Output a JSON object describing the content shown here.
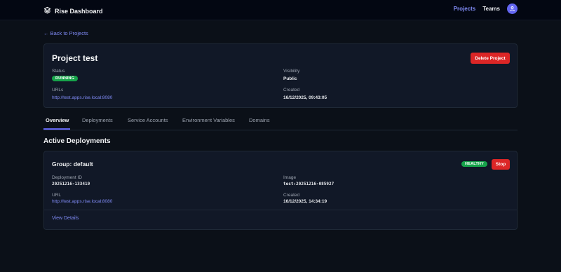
{
  "app": {
    "brand": "Rise Dashboard",
    "icon": "layers-icon"
  },
  "nav": {
    "projects": "Projects",
    "teams": "Teams",
    "avatar_icon": "user-icon"
  },
  "back_link": "← Back to Projects",
  "project": {
    "title": "Project test",
    "delete_label": "Delete Project",
    "status_label": "Status",
    "status_value": "RUNNING",
    "visibility_label": "Visibility",
    "visibility_value": "Public",
    "urls_label": "URLs",
    "url": "http://test.apps.rise.local:8080",
    "created_label": "Created",
    "created_value": "16/12/2025, 09:43:05"
  },
  "tabs": [
    {
      "label": "Overview",
      "active": true
    },
    {
      "label": "Deployments",
      "active": false
    },
    {
      "label": "Service Accounts",
      "active": false
    },
    {
      "label": "Environment Variables",
      "active": false
    },
    {
      "label": "Domains",
      "active": false
    }
  ],
  "active_deployments": {
    "title": "Active Deployments",
    "group_title": "Group: default",
    "health": "HEALTHY",
    "stop_label": "Stop",
    "deployment_id_label": "Deployment ID",
    "deployment_id": "20251216-133419",
    "image_label": "Image",
    "image": "test:20251216-085927",
    "url_label": "URL",
    "url": "http://test.apps.rise.local:8080",
    "created_label": "Created",
    "created_value": "16/12/2025, 14:34:19",
    "view_details": "View Details"
  },
  "colors": {
    "background": "#0b1018",
    "accent": "#818cf8",
    "danger": "#dc2626",
    "success": "#16a34a"
  }
}
